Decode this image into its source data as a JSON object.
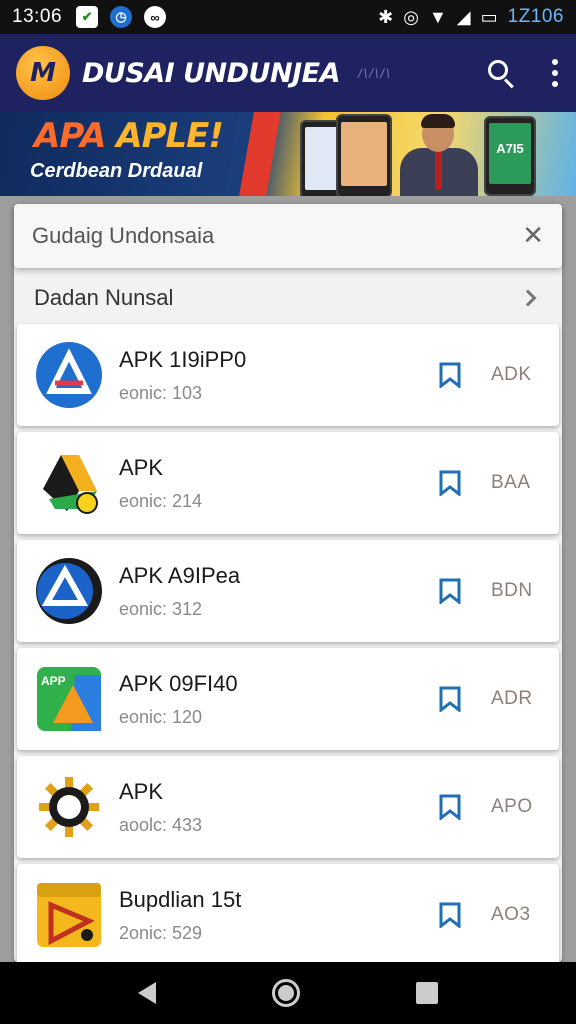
{
  "status_bar": {
    "time": "13:06",
    "clock_right": "1Z106",
    "icons": [
      "notification-app-icon",
      "notification-clock-icon",
      "notification-messenger-icon",
      "bluetooth-icon",
      "vibrate-icon",
      "wifi-icon",
      "signal-icon",
      "battery-icon"
    ]
  },
  "app_bar": {
    "logo_text": "M",
    "title": "DUSAI UNDUNJEA",
    "subtitle": "/\\/\\/\\",
    "brand_color": "#1e2260"
  },
  "banner": {
    "title_part1": "APA",
    "title_part2": "APLE!",
    "subtitle": "Cerdbean Drdaual",
    "phone_text": "A7I5"
  },
  "search": {
    "value": "Gudaig Undonsaia"
  },
  "section": {
    "label": "Dadan Nunsal"
  },
  "apps": [
    {
      "title": "APK 1I9iPP0",
      "sub": "eonic: 103",
      "action": "ADK",
      "icon": "app-store-icon"
    },
    {
      "title": "APK",
      "sub": "eonic: 214",
      "action": "BAA",
      "icon": "drive-triangle-icon"
    },
    {
      "title": "APK A9IPea",
      "sub": "eonic: 312",
      "action": "BDN",
      "icon": "triangle-badge-icon"
    },
    {
      "title": "APK 09FI40",
      "sub": "eonic: 120",
      "action": "ADR",
      "icon": "app-drive-icon"
    },
    {
      "title": "APK",
      "sub": "aoolc: 433",
      "action": "APO",
      "icon": "gear-icon"
    },
    {
      "title": "Bupdlian 15t",
      "sub": "2onic: 529",
      "action": "AO3",
      "icon": "video-play-icon"
    }
  ],
  "colors": {
    "accent": "#1f6fb5",
    "bookmark": "#1f6fb5"
  }
}
